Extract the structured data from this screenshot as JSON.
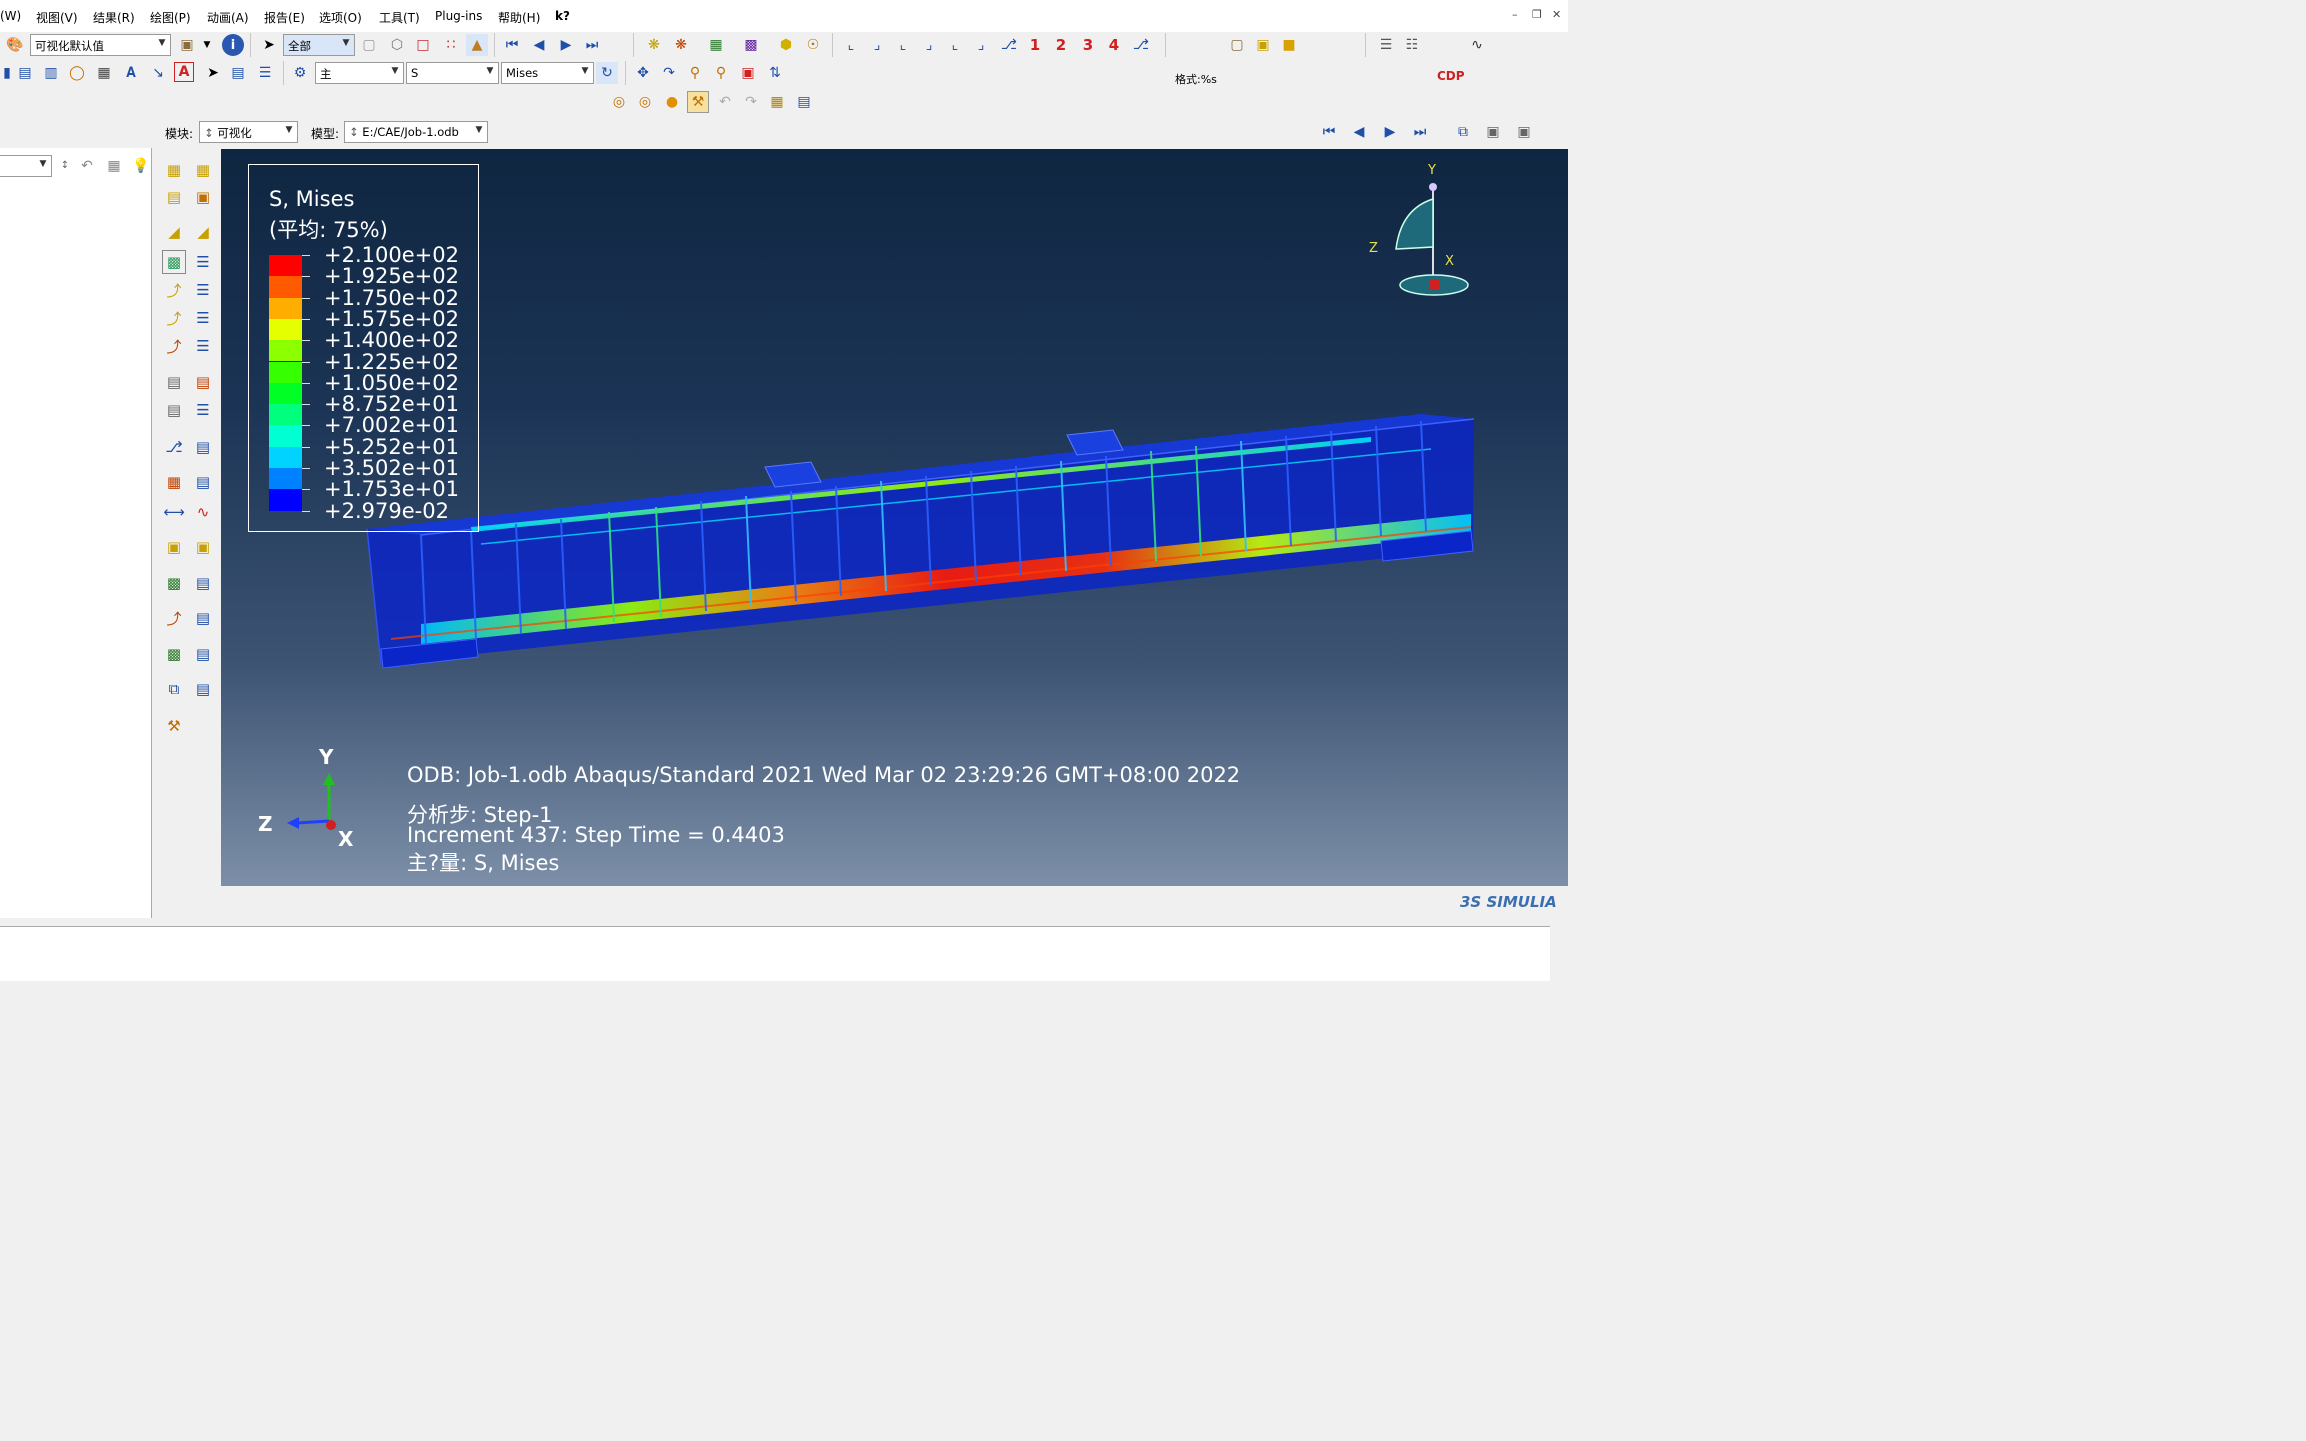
{
  "menu": [
    "(W)",
    "视图(V)",
    "结果(R)",
    "绘图(P)",
    "动画(A)",
    "报告(E)",
    "选项(O)",
    "工具(T)",
    "Plug-ins",
    "帮助(H)",
    "k?"
  ],
  "toolbar": {
    "color_scheme": "可视化默认值",
    "selection_filter": "全部",
    "display_group": "主",
    "field_output": "S",
    "invariant": "Mises",
    "view_numbers": [
      "1",
      "2",
      "3",
      "4"
    ],
    "format_label": "格式:%s",
    "cdp_label": "CDP"
  },
  "context": {
    "module_label": "模块:",
    "module_value": "可视化",
    "model_label": "模型:",
    "model_value": "E:/CAE/Job-1.odb"
  },
  "legend": {
    "title": "S, Mises",
    "subtitle": "(平均: 75%)",
    "values": [
      "+2.100e+02",
      "+1.925e+02",
      "+1.750e+02",
      "+1.575e+02",
      "+1.400e+02",
      "+1.225e+02",
      "+1.050e+02",
      "+8.752e+01",
      "+7.002e+01",
      "+5.252e+01",
      "+3.502e+01",
      "+1.753e+01",
      "+2.979e-02"
    ],
    "colors": [
      "#ff0000",
      "#ff5a00",
      "#ffae00",
      "#e6ff00",
      "#8cff00",
      "#35ff00",
      "#00ff25",
      "#00ff7c",
      "#00ffd2",
      "#00d3ff",
      "#0081ff",
      "#0028ff",
      "#0000ff"
    ]
  },
  "info": {
    "line1": "ODB: Job-1.odb    Abaqus/Standard 2021    Wed Mar 02 23:29:26 GMT+08:00 2022",
    "step": "分析步: Step-1",
    "increment": "Increment    437: Step Time =   0.4403",
    "primary_var": "主?量: S, Mises"
  },
  "triad": {
    "y": "Y",
    "z": "Z",
    "x": "X"
  },
  "view_cube": {
    "y": "Y",
    "z": "Z",
    "x": "X"
  },
  "brand": "3S SIMULIA",
  "colors": {
    "viewport_top": "#0f2641",
    "viewport_bottom": "#7d8fa8",
    "beam": "#0a25c8"
  }
}
